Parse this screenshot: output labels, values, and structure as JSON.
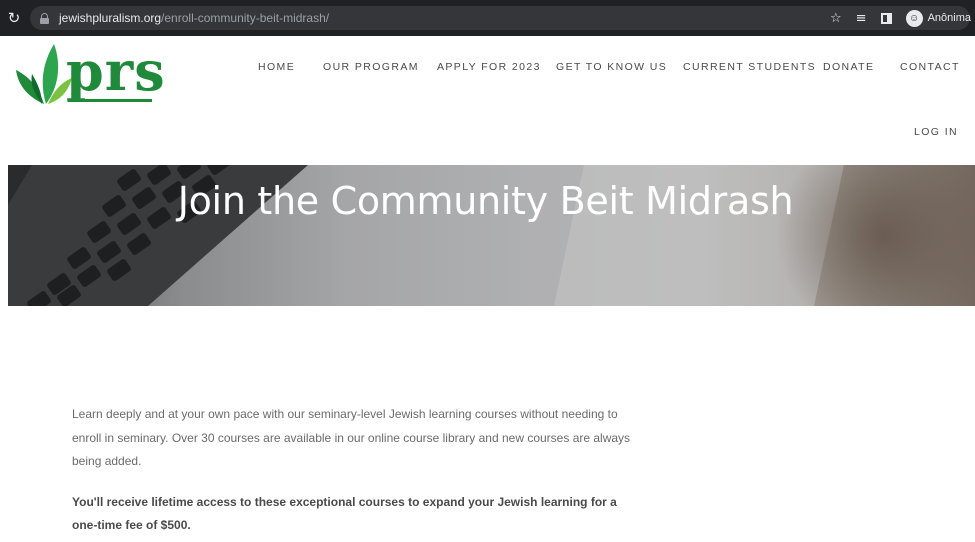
{
  "browser": {
    "url_domain": "jewishpluralism.org",
    "url_path": "/enroll-community-beit-midrash/",
    "profile_name": "Anônima",
    "icons": [
      "reload-icon",
      "lock-icon",
      "star-icon",
      "reading-list-icon",
      "side-panel-icon",
      "profile-icon"
    ]
  },
  "site": {
    "logo_text": "prs",
    "brand_color": "#1f8a3a",
    "nav": {
      "home": "HOME",
      "program": "OUR PROGRAM",
      "apply": "APPLY FOR 2023",
      "know": "GET TO KNOW US",
      "current": "CURRENT STUDENTS",
      "donate": "DONATE",
      "contact": "CONTACT",
      "login": "LOG IN"
    }
  },
  "hero": {
    "title": "Join the Community Beit Midrash"
  },
  "content": {
    "intro": "Learn deeply and at your own pace with our seminary-level Jewish learning courses without needing to enroll in seminary. Over 30 courses are available in our online course library and new courses are always being added.",
    "highlight": "You'll receive lifetime access to these exceptional courses to expand your Jewish learning for a one-time fee of $500."
  }
}
